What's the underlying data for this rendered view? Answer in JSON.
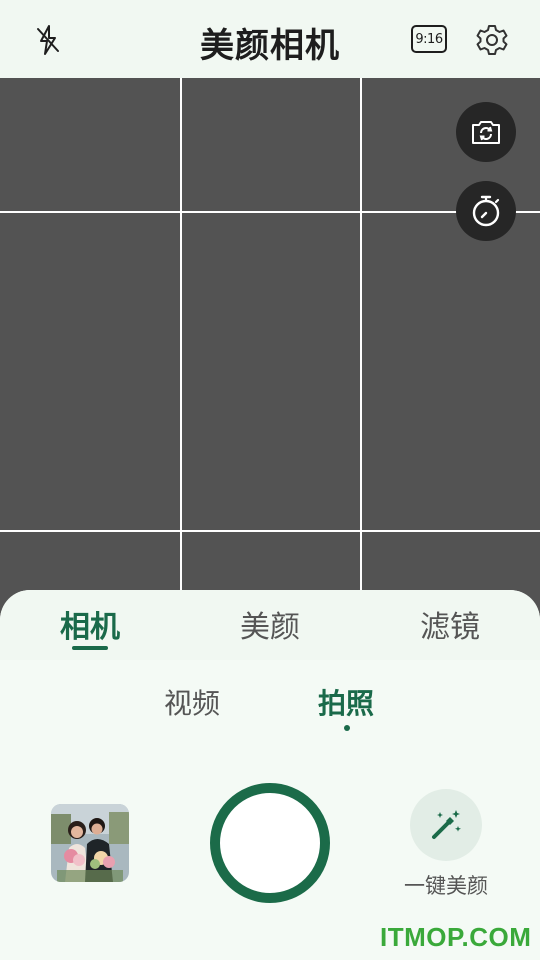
{
  "header": {
    "title": "美颜相机",
    "ratio_label": "9:16"
  },
  "tabs": [
    {
      "label": "相机",
      "active": true
    },
    {
      "label": "美颜",
      "active": false
    },
    {
      "label": "滤镜",
      "active": false
    }
  ],
  "modes": [
    {
      "label": "视频",
      "active": false
    },
    {
      "label": "拍照",
      "active": true
    }
  ],
  "beauty_button": {
    "label": "一键美颜"
  },
  "watermark": "ITMOP.COM",
  "colors": {
    "accent": "#1b6b49",
    "preview_bg": "#535353",
    "panel_bg": "#f4faf5",
    "watermark": "#3aa93a"
  },
  "icons": [
    "flash-off-icon",
    "aspect-ratio-icon",
    "gear-icon",
    "switch-camera-icon",
    "timer-icon",
    "magic-wand-icon"
  ]
}
